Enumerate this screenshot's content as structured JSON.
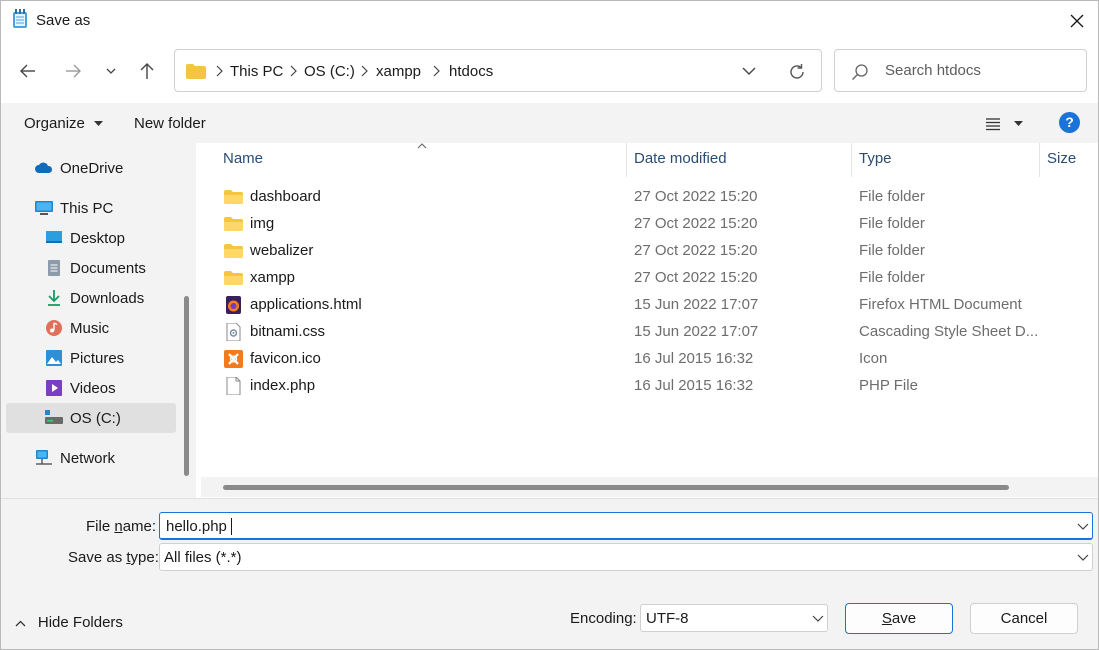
{
  "window": {
    "title": "Save as"
  },
  "address": {
    "crumbs": [
      "This PC",
      "OS (C:)",
      "xampp",
      "htdocs"
    ]
  },
  "search": {
    "placeholder": "Search htdocs"
  },
  "toolbar": {
    "organize_label": "Organize",
    "new_folder_label": "New folder"
  },
  "sidebar": {
    "items": [
      {
        "label": "OneDrive",
        "icon": "onedrive-icon"
      },
      {
        "label": "This PC",
        "icon": "computer-icon"
      },
      {
        "label": "Desktop",
        "icon": "desktop-icon"
      },
      {
        "label": "Documents",
        "icon": "documents-icon"
      },
      {
        "label": "Downloads",
        "icon": "downloads-icon"
      },
      {
        "label": "Music",
        "icon": "music-icon"
      },
      {
        "label": "Pictures",
        "icon": "pictures-icon"
      },
      {
        "label": "Videos",
        "icon": "videos-icon"
      },
      {
        "label": "OS (C:)",
        "icon": "drive-icon",
        "selected": true
      },
      {
        "label": "Network",
        "icon": "network-icon"
      }
    ]
  },
  "columns": {
    "name": "Name",
    "date": "Date modified",
    "type": "Type",
    "size": "Size"
  },
  "files": [
    {
      "name": "dashboard",
      "date": "27 Oct 2022 15:20",
      "type": "File folder",
      "icon": "folder-icon"
    },
    {
      "name": "img",
      "date": "27 Oct 2022 15:20",
      "type": "File folder",
      "icon": "folder-icon"
    },
    {
      "name": "webalizer",
      "date": "27 Oct 2022 15:20",
      "type": "File folder",
      "icon": "folder-icon"
    },
    {
      "name": "xampp",
      "date": "27 Oct 2022 15:20",
      "type": "File folder",
      "icon": "folder-icon"
    },
    {
      "name": "applications.html",
      "date": "15 Jun 2022 17:07",
      "type": "Firefox HTML Document",
      "icon": "html-file-icon"
    },
    {
      "name": "bitnami.css",
      "date": "15 Jun 2022 17:07",
      "type": "Cascading Style Sheet D...",
      "icon": "css-file-icon"
    },
    {
      "name": "favicon.ico",
      "date": "16 Jul 2015 16:32",
      "type": "Icon",
      "icon": "xampp-icon"
    },
    {
      "name": "index.php",
      "date": "16 Jul 2015 16:32",
      "type": "PHP File",
      "icon": "file-icon"
    }
  ],
  "form": {
    "file_name_label_pre": "File ",
    "file_name_label_u": "n",
    "file_name_label_post": "ame:",
    "file_name_value": "hello.php",
    "type_label_pre": "Save as ",
    "type_label_u": "t",
    "type_label_post": "ype:",
    "type_value": "All files  (*.*)"
  },
  "footer": {
    "hide_folders_label": "Hide Folders",
    "encoding_label": "Encoding:",
    "encoding_value": "UTF-8",
    "save_label_u": "S",
    "save_label_rest": "ave",
    "cancel_label": "Cancel"
  },
  "colors": {
    "accent": "#1a73d9",
    "folder": "#f5c542",
    "pane_bg": "#f3f3f3"
  }
}
